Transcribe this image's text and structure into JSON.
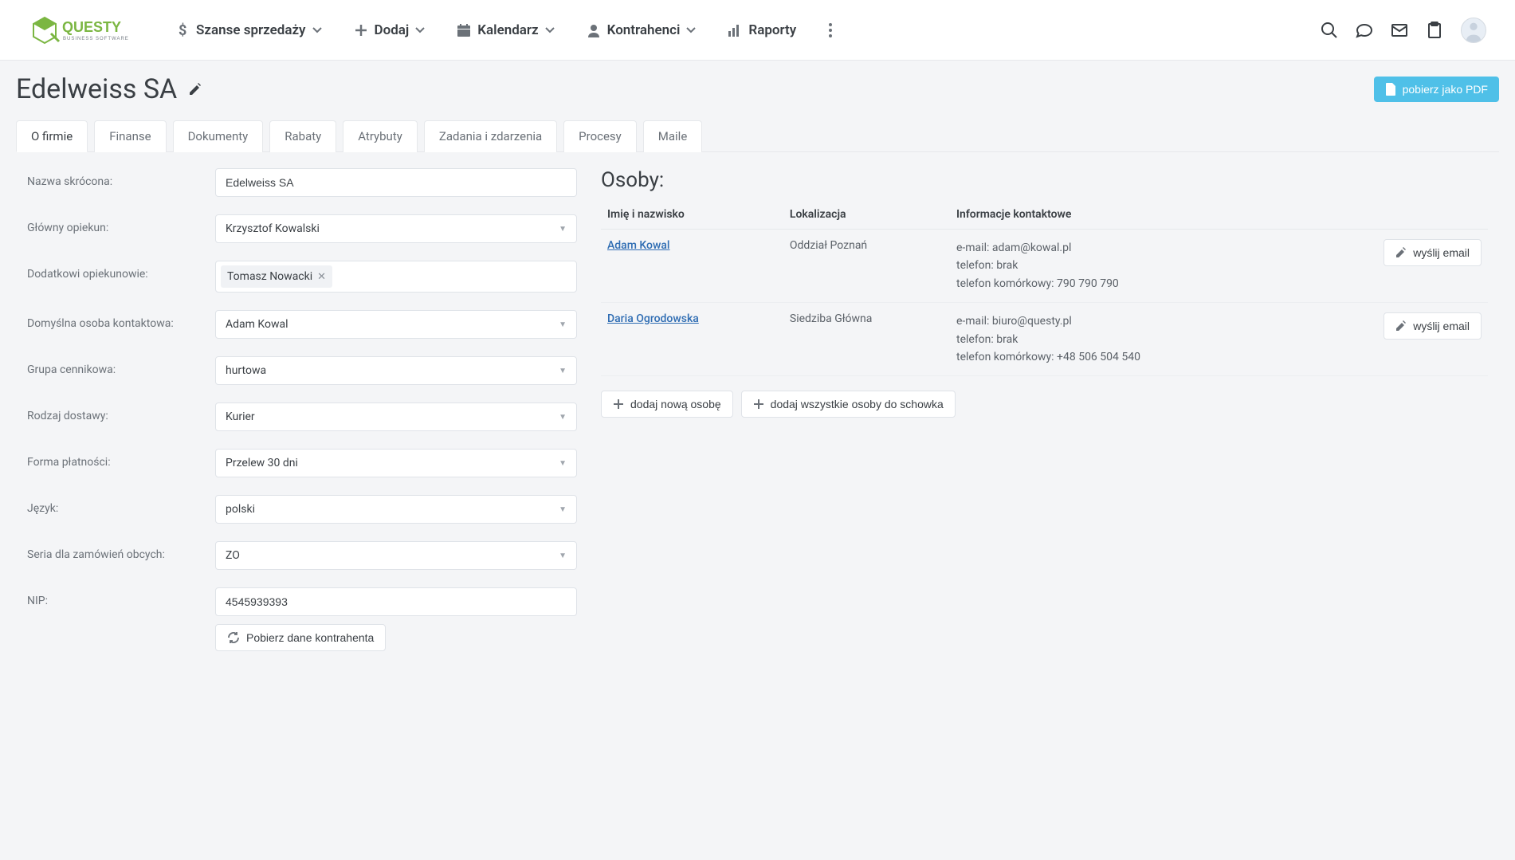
{
  "nav": {
    "sales_chances": "Szanse sprzedaży",
    "add": "Dodaj",
    "calendar": "Kalendarz",
    "contractors": "Kontrahenci",
    "reports": "Raporty"
  },
  "header": {
    "title": "Edelweiss SA",
    "pdf_button": "pobierz jako PDF"
  },
  "tabs": {
    "about": "O firmie",
    "finance": "Finanse",
    "documents": "Dokumenty",
    "discounts": "Rabaty",
    "attributes": "Atrybuty",
    "tasks": "Zadania i zdarzenia",
    "processes": "Procesy",
    "mails": "Maile"
  },
  "form": {
    "short_name_label": "Nazwa skrócona:",
    "short_name_value": "Edelweiss SA",
    "main_caretaker_label": "Główny opiekun:",
    "main_caretaker_value": "Krzysztof Kowalski",
    "extra_caretakers_label": "Dodatkowi opiekunowie:",
    "extra_caretaker_tag": "Tomasz Nowacki",
    "default_contact_label": "Domyślna osoba kontaktowa:",
    "default_contact_value": "Adam Kowal",
    "price_group_label": "Grupa cennikowa:",
    "price_group_value": "hurtowa",
    "delivery_type_label": "Rodzaj dostawy:",
    "delivery_type_value": "Kurier",
    "payment_form_label": "Forma płatności:",
    "payment_form_value": "Przelew 30 dni",
    "language_label": "Język:",
    "language_value": "polski",
    "series_label": "Seria dla zamówień obcych:",
    "series_value": "ZO",
    "nip_label": "NIP:",
    "nip_value": "4545939393",
    "fetch_contractor_btn": "Pobierz dane kontrahenta"
  },
  "persons": {
    "title": "Osoby:",
    "col_name": "Imię i nazwisko",
    "col_location": "Lokalizacja",
    "col_contact": "Informacje kontaktowe",
    "rows": [
      {
        "name": "Adam Kowal",
        "location": "Oddział Poznań",
        "email": "e-mail: adam@kowal.pl",
        "phone": "telefon: brak",
        "mobile": "telefon komórkowy: 790 790 790"
      },
      {
        "name": "Daria Ogrodowska",
        "location": "Siedziba Główna",
        "email": "e-mail: biuro@questy.pl",
        "phone": "telefon: brak",
        "mobile": "telefon komórkowy: +48 506 504 540"
      }
    ],
    "send_email_btn": "wyślij email",
    "add_person_btn": "dodaj nową osobę",
    "add_all_btn": "dodaj wszystkie osoby do schowka"
  }
}
